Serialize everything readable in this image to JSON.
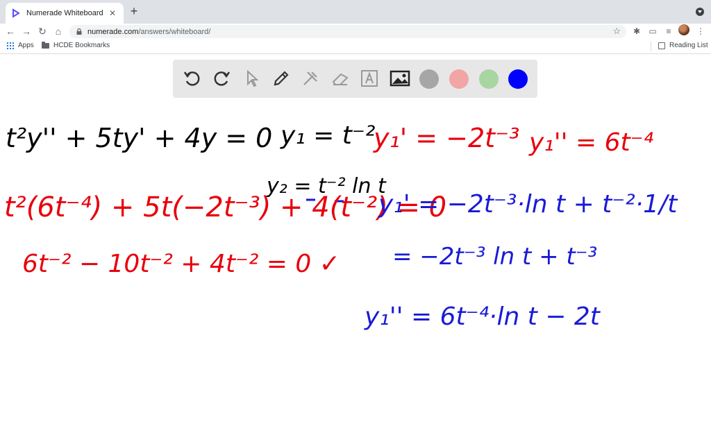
{
  "browser": {
    "tab": {
      "title": "Numerade Whiteboard"
    },
    "new_tab_label": "+",
    "url": {
      "host": "numerade.com",
      "path": "/answers/whiteboard/"
    },
    "bookmarks": {
      "apps_label": "Apps",
      "folder_label": "HCDE Bookmarks",
      "reading_list_label": "Reading List"
    }
  },
  "whiteboard": {
    "tools": [
      "undo-icon",
      "redo-icon",
      "select-icon",
      "pen-icon",
      "tools-icon",
      "eraser-icon",
      "text-icon",
      "image-icon"
    ],
    "colors": [
      "#a6a6a6",
      "#f2a5a5",
      "#a8d5a2",
      "#0000ff"
    ],
    "ink_colors": {
      "black": "#000000",
      "red": "#e8000b",
      "blue": "#1a1ad6"
    },
    "strokes": {
      "black_ode": "t²y'' + 5ty' + 4y = 0",
      "black_y1": "y₁ = t⁻²",
      "black_y2": "y₂ = t⁻² ln t",
      "red_y1p": "y₁' = −2t⁻³",
      "red_y1pp": "y₁'' = 6t⁻⁴",
      "red_sub": "t²(6t⁻⁴) + 5t(−2t⁻³) + 4(t⁻²) = 0",
      "red_check": "6t⁻² − 10t⁻² + 4t⁻² = 0 ✓",
      "blue_y2p": "y₁' = −2t⁻³·ln t + t⁻²·1/t",
      "blue_simplified": "= −2t⁻³ ln t + t⁻³",
      "blue_y2pp": "y₁'' = 6t⁻⁴·ln t − 2t"
    }
  }
}
